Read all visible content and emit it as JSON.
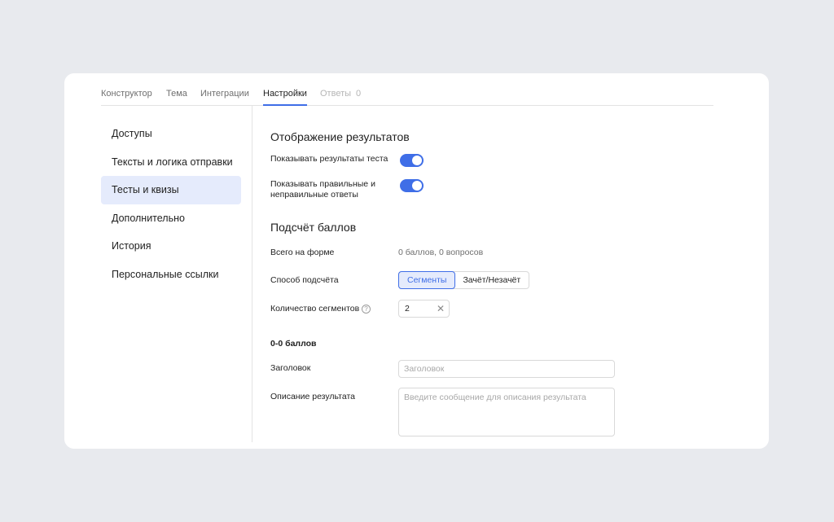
{
  "tabs": [
    {
      "label": "Конструктор"
    },
    {
      "label": "Тема"
    },
    {
      "label": "Интеграции"
    },
    {
      "label": "Настройки"
    },
    {
      "label": "Ответы",
      "count": "0"
    }
  ],
  "sidebar": {
    "items": [
      {
        "label": "Доступы"
      },
      {
        "label": "Тексты и логика отправки"
      },
      {
        "label": "Тесты и квизы",
        "active": true
      },
      {
        "label": "Дополнительно"
      },
      {
        "label": "История"
      },
      {
        "label": "Персональные ссылки"
      }
    ]
  },
  "results": {
    "title": "Отображение результатов",
    "show_results_label": "Показывать результаты теста",
    "show_results_on": true,
    "show_answers_label_line1": "Показывать правильные и",
    "show_answers_label_line2": "неправильные ответы",
    "show_answers_on": true
  },
  "scoring": {
    "title": "Подсчёт баллов",
    "total_label": "Всего на форме",
    "total_value": "0 баллов, 0 вопросов",
    "method_label": "Способ подсчёта",
    "method_options": [
      "Сегменты",
      "Зачёт/Незачёт"
    ],
    "method_selected": "Сегменты",
    "segments_label": "Количество сегментов",
    "segments_value": "2",
    "help_glyph": "?",
    "clear_glyph": "✕"
  },
  "segment": {
    "title": "0-0 баллов",
    "heading_label": "Заголовок",
    "heading_placeholder": "Заголовок",
    "description_label": "Описание результата",
    "description_placeholder": "Введите сообщение для описания результата"
  },
  "colors": {
    "accent": "#3f6ee7",
    "active_bg": "#e5ebfc",
    "page_bg": "#e8eaee"
  },
  "icons": [
    "help-icon",
    "clear-icon"
  ]
}
